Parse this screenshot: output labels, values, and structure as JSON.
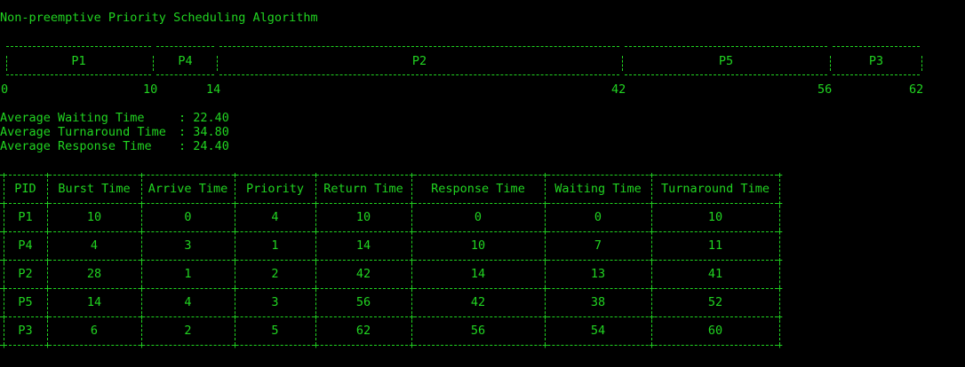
{
  "title": "Non-preemptive Priority Scheduling Algorithm",
  "colors": {
    "background": "#000000",
    "text": "#21d421"
  },
  "gantt": {
    "blocks": [
      {
        "label": "P1"
      },
      {
        "label": "P4"
      },
      {
        "label": "P2"
      },
      {
        "label": "P5"
      },
      {
        "label": "P3"
      }
    ],
    "ticks": [
      "0",
      "10",
      "14",
      "42",
      "56",
      "62"
    ]
  },
  "averages": [
    {
      "label": "Average Waiting Time",
      "value": "22.40"
    },
    {
      "label": "Average Turnaround Time",
      "value": "34.80"
    },
    {
      "label": "Average Response Time",
      "value": "24.40"
    }
  ],
  "table": {
    "headers": [
      "PID",
      "Burst Time",
      "Arrive Time",
      "Priority",
      "Return Time",
      "Response Time",
      "Waiting Time",
      "Turnaround Time"
    ],
    "rows": [
      [
        "P1",
        "10",
        "0",
        "4",
        "10",
        "0",
        "0",
        "10"
      ],
      [
        "P4",
        "4",
        "3",
        "1",
        "14",
        "10",
        "7",
        "11"
      ],
      [
        "P2",
        "28",
        "1",
        "2",
        "42",
        "14",
        "13",
        "41"
      ],
      [
        "P5",
        "14",
        "4",
        "3",
        "56",
        "42",
        "38",
        "52"
      ],
      [
        "P3",
        "6",
        "2",
        "5",
        "62",
        "56",
        "54",
        "60"
      ]
    ]
  }
}
